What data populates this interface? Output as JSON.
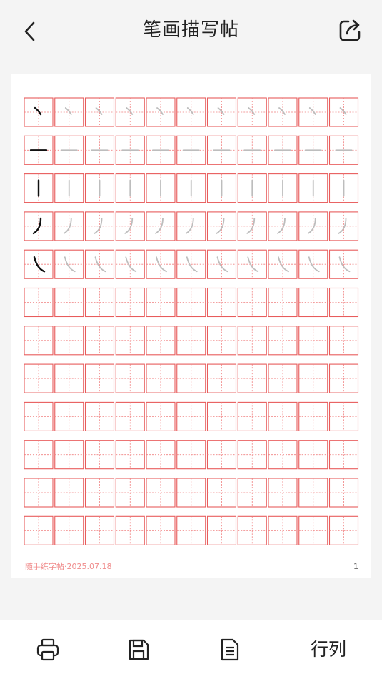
{
  "header": {
    "title": "笔画描写帖"
  },
  "icons": {
    "back": "chevron-left-icon",
    "share": "share-icon",
    "print": "printer-icon",
    "save": "floppy-disk-icon",
    "document": "document-icon"
  },
  "paper": {
    "footer_left": "随手练字帖·2025.07.18",
    "page_number": "1",
    "rows": 12,
    "cols": 11,
    "practice_strokes": [
      {
        "name": "dian",
        "example": "丶"
      },
      {
        "name": "heng",
        "example": "一"
      },
      {
        "name": "shu",
        "example": "丨"
      },
      {
        "name": "pie",
        "example": "丿"
      },
      {
        "name": "na",
        "example": "㇏"
      }
    ]
  },
  "toolbar": {
    "layout_label": "行列"
  },
  "colors": {
    "grid": "#e85c5c",
    "guide": "#f08080",
    "trace": "#bdbdbd",
    "ink": "#111111",
    "background": "#f4f4f4"
  }
}
